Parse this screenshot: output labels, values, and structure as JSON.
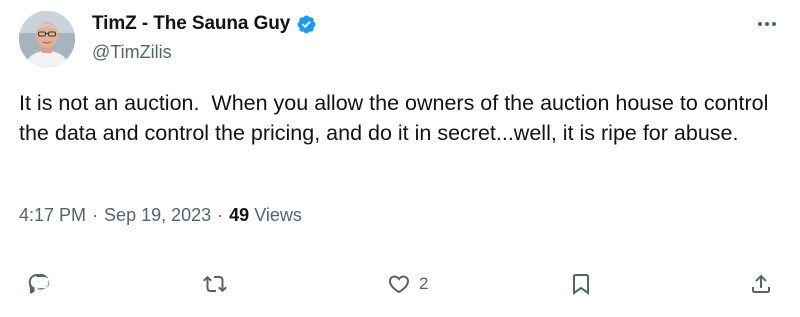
{
  "tweet": {
    "author": {
      "display_name": "TimZ - The Sauna Guy",
      "handle": "@TimZilis",
      "verified": true
    },
    "text": "It is not an auction.  When you allow the owners of the auction house to control the data and control the pricing, and do it in secret...well, it is ripe for abuse.",
    "time": "4:17 PM",
    "date": "Sep 19, 2023",
    "separator": "·",
    "views": {
      "count": "49",
      "label": "Views"
    },
    "actions": {
      "reply": {
        "icon": "reply-icon"
      },
      "retweet": {
        "icon": "retweet-icon"
      },
      "like": {
        "icon": "heart-icon",
        "count": "2"
      },
      "bookmark": {
        "icon": "bookmark-icon"
      },
      "share": {
        "icon": "share-icon"
      }
    },
    "more_icon": "more-icon"
  },
  "colors": {
    "text_primary": "#0f1419",
    "text_secondary": "#536471",
    "verified_blue": "#1d9bf0"
  }
}
